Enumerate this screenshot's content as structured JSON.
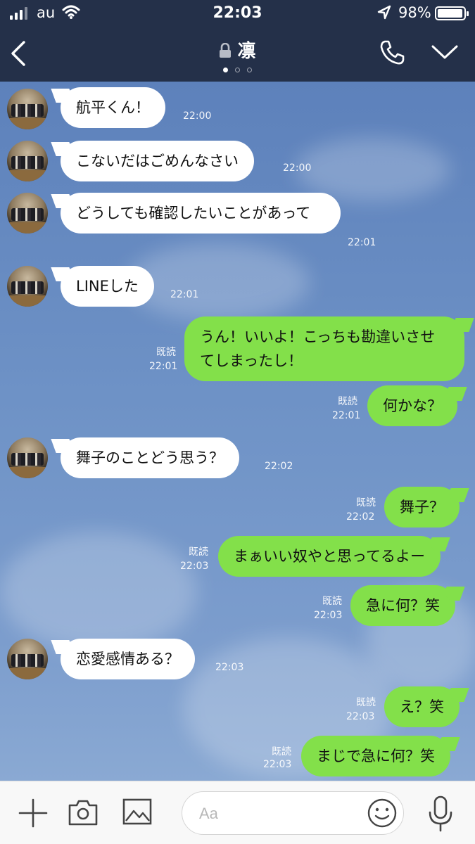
{
  "status_bar": {
    "carrier": "au",
    "time": "22:03",
    "battery": "98%",
    "battery_level": 0.98
  },
  "header": {
    "title": "凛",
    "page_indicator_count": 3,
    "page_indicator_active": 0
  },
  "messages": [
    {
      "from": "them",
      "text": "航平くん！",
      "time": "22:00"
    },
    {
      "from": "them",
      "text": "こないだはごめんなさい",
      "time": "22:00"
    },
    {
      "from": "them",
      "text": "どうしても確認したいことがあって",
      "time": "22:01"
    },
    {
      "from": "them",
      "text": "LINEした",
      "time": "22:01"
    },
    {
      "from": "me",
      "text": "うん！いいよ！こっちも勘違いさせてしまったし！",
      "read": "既読",
      "time": "22:01"
    },
    {
      "from": "me",
      "text": "何かな？",
      "read": "既読",
      "time": "22:01"
    },
    {
      "from": "them",
      "text": "舞子のことどう思う？",
      "time": "22:02"
    },
    {
      "from": "me",
      "text": "舞子？",
      "read": "既読",
      "time": "22:02"
    },
    {
      "from": "me",
      "text": "まぁいい奴やと思ってるよー",
      "read": "既読",
      "time": "22:03"
    },
    {
      "from": "me",
      "text": "急に何？笑",
      "read": "既読",
      "time": "22:03"
    },
    {
      "from": "them",
      "text": "恋愛感情ある？",
      "time": "22:03"
    },
    {
      "from": "me",
      "text": "え？笑",
      "read": "既読",
      "time": "22:03"
    },
    {
      "from": "me",
      "text": "まじで急に何？笑",
      "read": "既読",
      "time": "22:03"
    }
  ],
  "input": {
    "placeholder": "Aa"
  },
  "colors": {
    "header_bg": "#243049",
    "chat_bg": "#6f8fbf",
    "incoming_bubble": "#ffffff",
    "outgoing_bubble": "#83e04a"
  },
  "icons": {
    "back": "chevron-left-icon",
    "lock": "lock-icon",
    "call": "phone-icon",
    "menu": "chevron-down-icon",
    "add": "plus-icon",
    "camera": "camera-icon",
    "image": "image-icon",
    "emoji": "smiley-icon",
    "voice": "microphone-icon"
  }
}
